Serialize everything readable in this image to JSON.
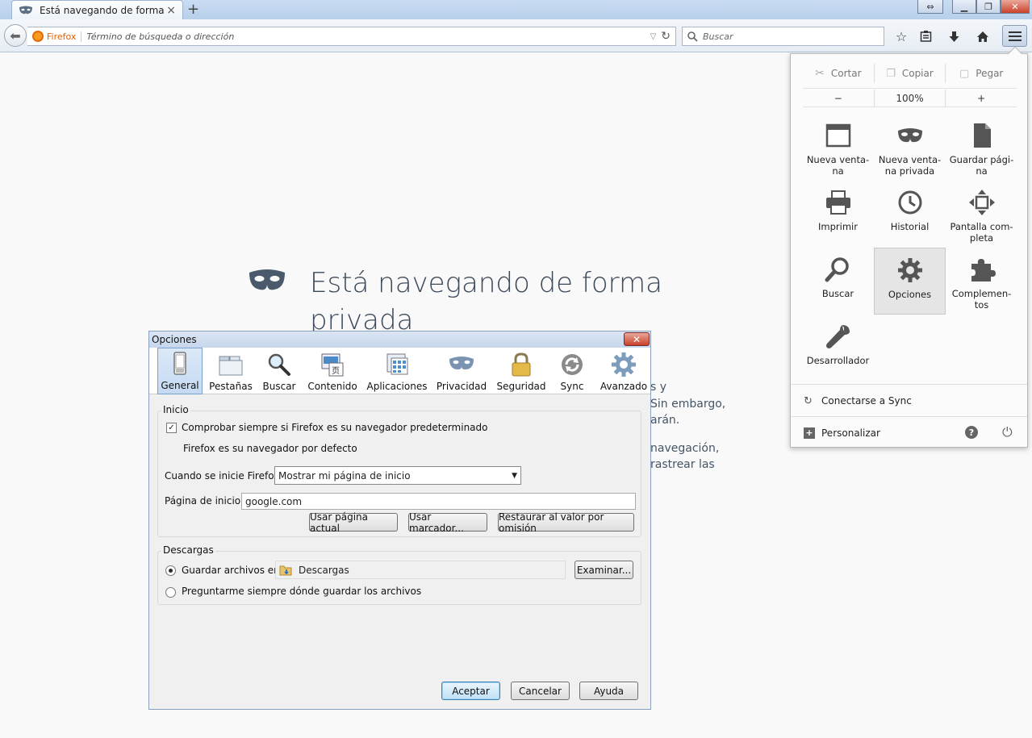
{
  "browser": {
    "tab_title": "Está navegando de forma ...",
    "tab_close": "×",
    "new_tab": "+",
    "window_controls": {
      "minimize": "▁",
      "restore": "❐",
      "close": "✕"
    },
    "url": {
      "identity_label": "Firefox",
      "placeholder": "Término de búsqueda o dirección"
    },
    "search": {
      "placeholder": "Buscar"
    }
  },
  "private_page": {
    "title": "Está navegando de forma privada",
    "fragments": [
      "s y",
      "Sin embargo,",
      "arán.",
      "navegación,",
      "rastrear las"
    ]
  },
  "menu_panel": {
    "edit": {
      "cut": "Cortar",
      "copy": "Copiar",
      "paste": "Pegar"
    },
    "zoom": {
      "out": "−",
      "level": "100%",
      "in": "+"
    },
    "items": [
      {
        "label": "Nueva venta-\nna",
        "icon": "window-icon"
      },
      {
        "label": "Nueva venta-\nna privada",
        "icon": "mask-icon"
      },
      {
        "label": "Guardar pági-\nna",
        "icon": "page-icon"
      },
      {
        "label": "Imprimir",
        "icon": "printer-icon"
      },
      {
        "label": "Historial",
        "icon": "clock-icon"
      },
      {
        "label": "Pantalla com-\npleta",
        "icon": "fullscreen-icon"
      },
      {
        "label": "Buscar",
        "icon": "magnifier-icon"
      },
      {
        "label": "Opciones",
        "icon": "gear-icon"
      },
      {
        "label": "Complemen-\ntos",
        "icon": "puzzle-icon"
      },
      {
        "label": "Desarrollador",
        "icon": "wrench-icon"
      }
    ],
    "sync": "Conectarse a Sync",
    "customize": "Personalizar"
  },
  "dialog": {
    "title": "Opciones",
    "close": "✕",
    "tabs": [
      "General",
      "Pestañas",
      "Buscar",
      "Contenido",
      "Aplicaciones",
      "Privacidad",
      "Seguridad",
      "Sync",
      "Avanzado"
    ],
    "startup": {
      "group": "Inicio",
      "check_default": "Comprobar siempre si Firefox es su navegador predeterminado",
      "check_mark": "✓",
      "is_default": "Firefox es su navegador por defecto",
      "when_starts_label": "Cuando se inicie Firefox:",
      "when_starts_value": "Mostrar mi página de inicio",
      "home_label": "Página de inicio:",
      "home_value": "google.com",
      "btn_current": "Usar página actual",
      "btn_bookmark": "Usar marcador...",
      "btn_restore": "Restaurar al valor por omisión"
    },
    "downloads": {
      "group": "Descargas",
      "save_to": "Guardar archivos en",
      "folder": "Descargas",
      "browse": "Examinar...",
      "ask": "Preguntarme siempre dónde guardar los archivos"
    },
    "buttons": {
      "ok": "Aceptar",
      "cancel": "Cancelar",
      "help": "Ayuda"
    }
  }
}
